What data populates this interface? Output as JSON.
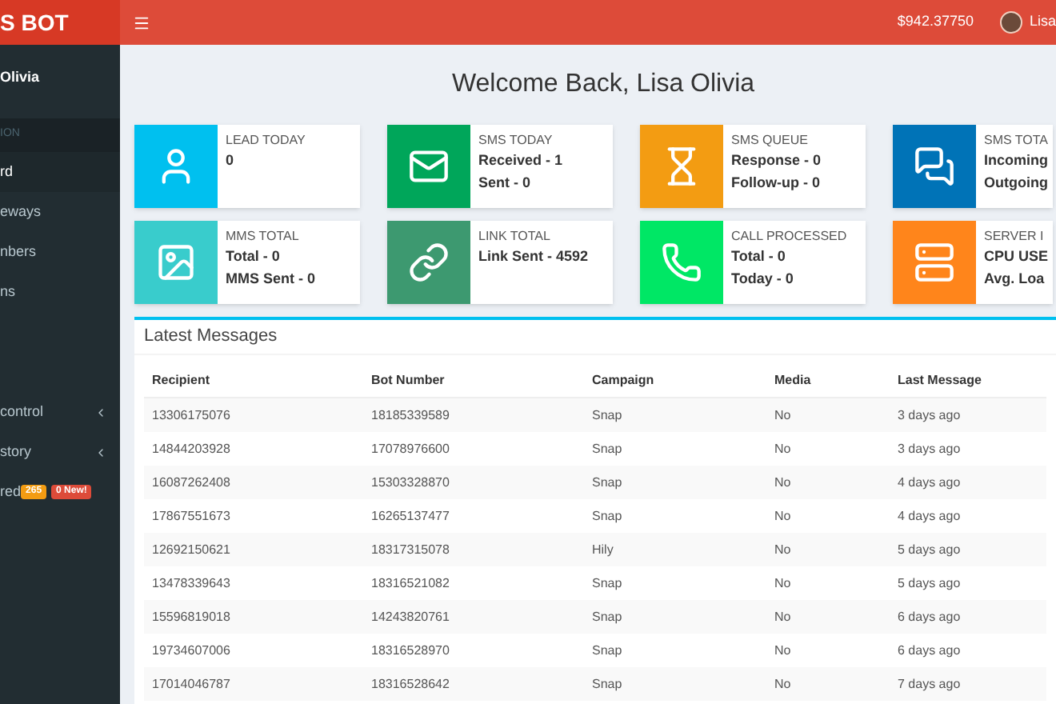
{
  "logo": "S BOT",
  "header": {
    "balance": "$942.37750",
    "user": "Lisa"
  },
  "sidebar": {
    "user": "Olivia",
    "section": "ION",
    "items": [
      {
        "label": "rd",
        "selected": true,
        "caret": false
      },
      {
        "label": "eways",
        "selected": false,
        "caret": false
      },
      {
        "label": "nbers",
        "selected": false,
        "caret": false
      },
      {
        "label": "ns",
        "selected": false,
        "caret": false
      }
    ],
    "lower_items": [
      {
        "label": "control",
        "selected": false,
        "caret": true
      },
      {
        "label": "story",
        "selected": false,
        "caret": true
      },
      {
        "label": "red",
        "selected": false,
        "badges": [
          {
            "text": "265",
            "color": "#f39c12"
          },
          {
            "text": "0 New!",
            "color": "#dd4b39"
          }
        ]
      }
    ]
  },
  "welcome": "Welcome Back, Lisa Olivia",
  "cards": [
    {
      "kind": "user",
      "color": "#00c0ef",
      "title": "LEAD TODAY",
      "lines": [
        "0"
      ]
    },
    {
      "kind": "mail",
      "color": "#00a65a",
      "title": "SMS TODAY",
      "lines": [
        "Received - 1",
        "Sent - 0"
      ]
    },
    {
      "kind": "hourglass",
      "color": "#f39c12",
      "title": "SMS QUEUE",
      "lines": [
        "Response - 0",
        "Follow-up - 0"
      ]
    },
    {
      "kind": "chat",
      "color": "#0073b7",
      "title": "SMS TOTA",
      "lines": [
        "Incoming",
        "Outgoing"
      ]
    },
    {
      "kind": "image",
      "color": "#39cccc",
      "title": "MMS TOTAL",
      "lines": [
        "Total - 0",
        "MMS Sent - 0"
      ]
    },
    {
      "kind": "link",
      "color": "#3d9970",
      "title": "LINK TOTAL",
      "lines": [
        "Link Sent - 4592"
      ]
    },
    {
      "kind": "phone",
      "color": "#00e765",
      "title": "CALL PROCESSED",
      "lines": [
        "Total - 0",
        "Today - 0"
      ]
    },
    {
      "kind": "server",
      "color": "#ff851b",
      "title": "SERVER I",
      "lines": [
        "CPU USE",
        "Avg. Loa"
      ]
    }
  ],
  "table": {
    "title": "Latest Messages",
    "columns": [
      "Recipient",
      "Bot Number",
      "Campaign",
      "Media",
      "Last Message"
    ],
    "rows": [
      [
        "13306175076",
        "18185339589",
        "Snap",
        "No",
        "3 days ago"
      ],
      [
        "14844203928",
        "17078976600",
        "Snap",
        "No",
        "3 days ago"
      ],
      [
        "16087262408",
        "15303328870",
        "Snap",
        "No",
        "4 days ago"
      ],
      [
        "17867551673",
        "16265137477",
        "Snap",
        "No",
        "4 days ago"
      ],
      [
        "12692150621",
        "18317315078",
        "Hily",
        "No",
        "5 days ago"
      ],
      [
        "13478339643",
        "18316521082",
        "Snap",
        "No",
        "5 days ago"
      ],
      [
        "15596819018",
        "14243820761",
        "Snap",
        "No",
        "6 days ago"
      ],
      [
        "19734607006",
        "18316528970",
        "Snap",
        "No",
        "6 days ago"
      ],
      [
        "17014046787",
        "18316528642",
        "Snap",
        "No",
        "7 days ago"
      ]
    ]
  }
}
